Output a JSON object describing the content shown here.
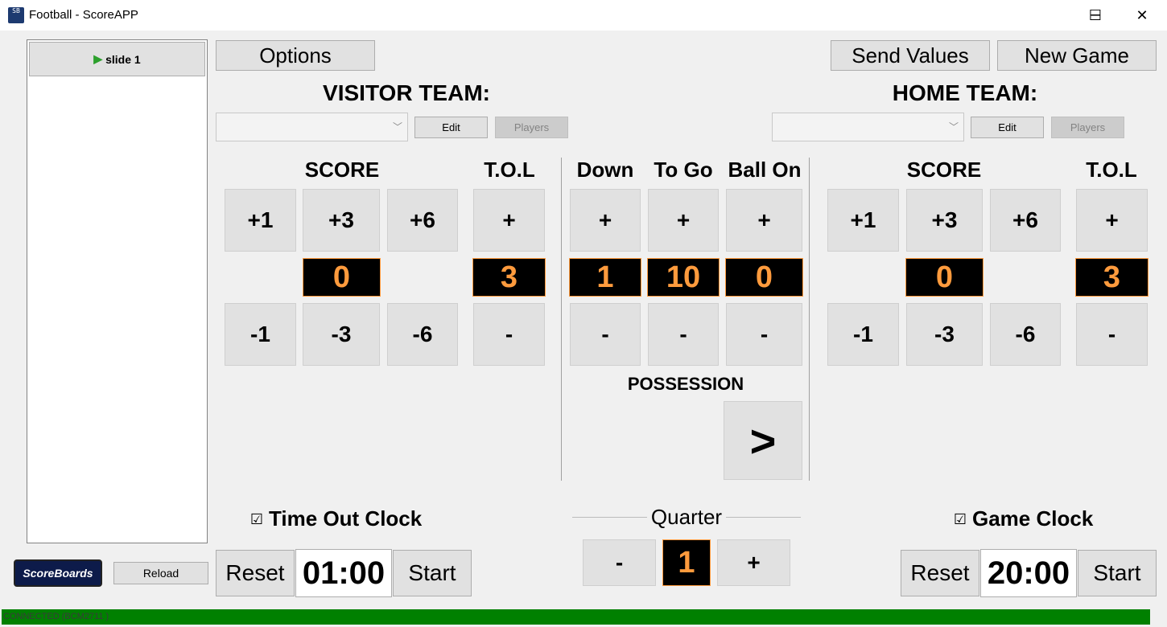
{
  "window": {
    "title": "Football - ScoreAPP",
    "icon_text": "SB",
    "minimize_icon": "─",
    "maximize_icon": "☐",
    "close_icon": "✕"
  },
  "sidebar": {
    "slide_label": "slide 1",
    "logo_text": "ScoreBoards",
    "reload_label": "Reload"
  },
  "toolbar": {
    "options_label": "Options",
    "send_values_label": "Send Values",
    "new_game_label": "New Game"
  },
  "visitor": {
    "title": "VISITOR TEAM:",
    "team_value": "",
    "edit_label": "Edit",
    "players_label": "Players",
    "score_header": "SCORE",
    "tol_header": "T.O.L",
    "plus1": "+1",
    "plus3": "+3",
    "plus6": "+6",
    "tol_plus": "+",
    "minus1": "-1",
    "minus3": "-3",
    "minus6": "-6",
    "tol_minus": "-",
    "score": "0",
    "tol": "3"
  },
  "home": {
    "title": "HOME TEAM:",
    "team_value": "",
    "edit_label": "Edit",
    "players_label": "Players",
    "score_header": "SCORE",
    "tol_header": "T.O.L",
    "plus1": "+1",
    "plus3": "+3",
    "plus6": "+6",
    "tol_plus": "+",
    "minus1": "-1",
    "minus3": "-3",
    "minus6": "-6",
    "tol_minus": "-",
    "score": "0",
    "tol": "3"
  },
  "game": {
    "down_header": "Down",
    "togo_header": "To Go",
    "ballon_header": "Ball On",
    "plus": "+",
    "minus": "-",
    "down": "1",
    "togo": "10",
    "ballon": "0",
    "possession_label": "POSSESSION",
    "possession_arrow": ">"
  },
  "timeout_clock": {
    "label": "Time Out Clock",
    "checked": "☑",
    "reset_label": "Reset",
    "time": "01:00",
    "start_label": "Start"
  },
  "quarter": {
    "label": "Quarter",
    "minus": "-",
    "value": "1",
    "plus": "+"
  },
  "game_clock": {
    "label": "Game Clock",
    "checked": "☑",
    "reset_label": "Reset",
    "time": "20:00",
    "start_label": "Start"
  },
  "status": {
    "text": "CONNECTED (BCM2711 )",
    "color": "#008000"
  },
  "colors": {
    "display_text": "#ff9b3d",
    "display_bg": "#000000"
  }
}
